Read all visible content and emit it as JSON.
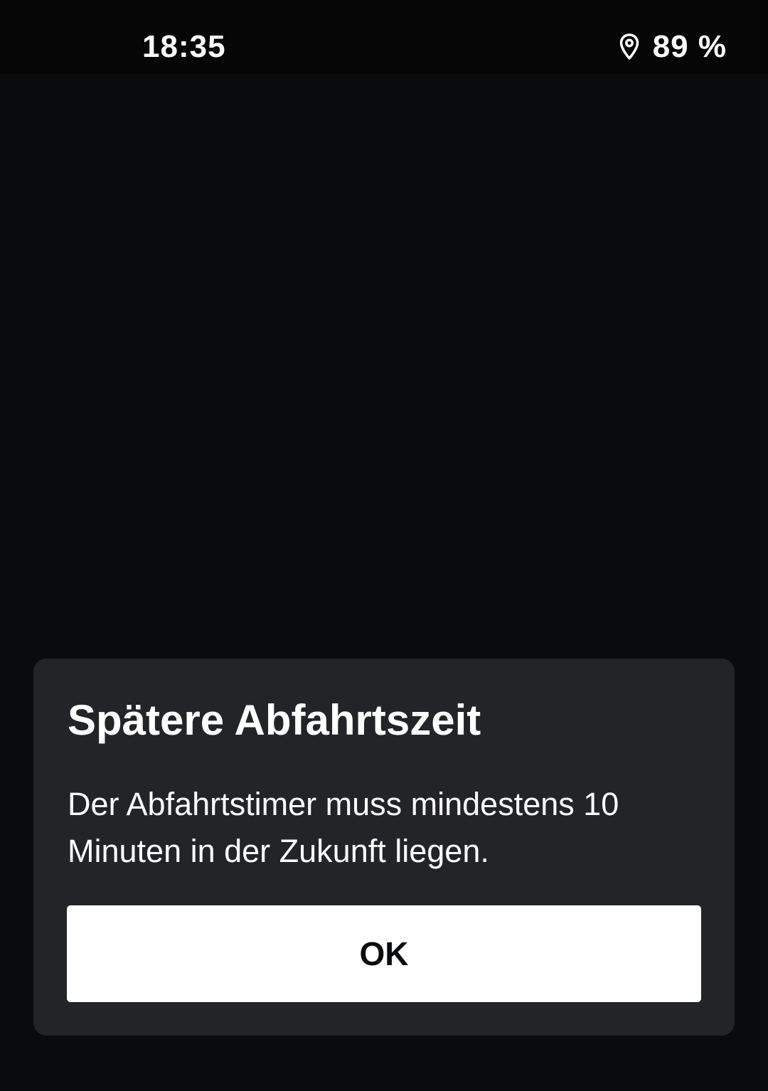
{
  "status_bar": {
    "time": "18:35",
    "battery": "89 %",
    "location_icon": "location-pin-icon"
  },
  "dialog": {
    "title": "Spätere Abfahrtszeit",
    "message": "Der Abfahrtstimer muss mindestens 10 Minuten in der Zukunft liegen.",
    "ok_label": "OK"
  },
  "colors": {
    "background": "#0a0b0d",
    "dialog_background": "#232427",
    "button_background": "#ffffff",
    "button_text": "#0a0b0d",
    "text": "#ffffff"
  }
}
